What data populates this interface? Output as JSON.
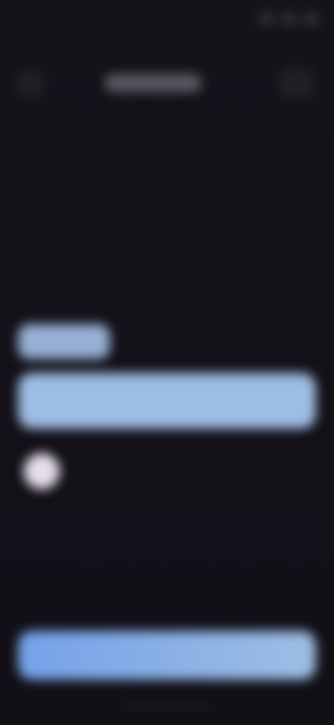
{
  "status_bar": {
    "time": "",
    "icons": [
      "signal-icon",
      "wifi-icon",
      "battery-icon"
    ]
  },
  "header": {
    "title": "",
    "left_icon": "back-icon",
    "right_icon": "menu-icon"
  },
  "form": {
    "label": "",
    "input_value": "",
    "input_placeholder": ""
  },
  "actions": {
    "primary_button_label": ""
  },
  "colors": {
    "background": "#131018",
    "accent_light": "#AACCF5",
    "accent_primary": "#7AAAF5",
    "indicator": "#F0EBF5"
  }
}
